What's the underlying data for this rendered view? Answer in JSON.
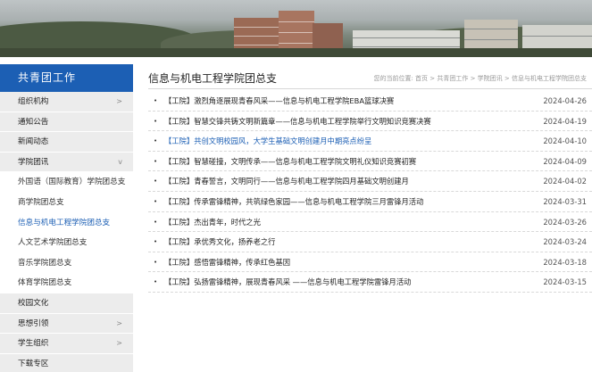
{
  "sidebar": {
    "heading": "共青团工作",
    "items": [
      {
        "label": "组织机构",
        "arrow": ">"
      },
      {
        "label": "通知公告",
        "arrow": ""
      },
      {
        "label": "新闻动态",
        "arrow": ""
      },
      {
        "label": "学院团讯",
        "arrow": "v"
      }
    ],
    "subitems": [
      {
        "label": "外国语（国际教育）学院团总支"
      },
      {
        "label": "商学院团总支"
      },
      {
        "label": "信息与机电工程学院团总支"
      },
      {
        "label": "人文艺术学院团总支"
      },
      {
        "label": "音乐学院团总支"
      },
      {
        "label": "体育学院团总支"
      }
    ],
    "items_after": [
      {
        "label": "校园文化",
        "arrow": ""
      },
      {
        "label": "思想引领",
        "arrow": ">"
      },
      {
        "label": "学生组织",
        "arrow": ">"
      },
      {
        "label": "下载专区",
        "arrow": ""
      }
    ]
  },
  "main": {
    "title": "信息与机电工程学院团总支",
    "location_label": "您的当前位置:",
    "breadcrumb": "首页 > 共青团工作 > 学院团讯 > 信息与机电工程学院团总支",
    "bullet": "•",
    "news": [
      {
        "title": "【工院】激烈角逐展现青春风采——信息与机电工程学院EBA篮球决赛",
        "date": "2024-04-26"
      },
      {
        "title": "【工院】智慧交锋共铸文明新篇章——信息与机电工程学院举行文明知识竞赛决赛",
        "date": "2024-04-19"
      },
      {
        "title": "【工院】共创文明校园风，大学生基础文明创建月中期亮点纷呈",
        "date": "2024-04-10"
      },
      {
        "title": "【工院】智慧碰撞，文明传承——信息与机电工程学院文明礼仪知识竞赛初赛",
        "date": "2024-04-09"
      },
      {
        "title": "【工院】青春誓言，文明同行——信息与机电工程学院四月基础文明创建月",
        "date": "2024-04-02"
      },
      {
        "title": "【工院】传承雷锋精神，共筑绿色家园——信息与机电工程学院三月雷锋月活动",
        "date": "2024-03-31"
      },
      {
        "title": "【工院】杰出青年，时代之光",
        "date": "2024-03-26"
      },
      {
        "title": "【工院】承优秀文化，扬养老之行",
        "date": "2024-03-24"
      },
      {
        "title": "【工院】感悟雷锋精神，传承红色基因",
        "date": "2024-03-18"
      },
      {
        "title": "【工院】弘扬雷锋精神，展现青春风采 ——信息与机电工程学院雷锋月活动",
        "date": "2024-03-15"
      }
    ]
  },
  "colors": {
    "accent": "#1c5fb4",
    "sidebar_bg": "#ececec",
    "link_highlight": "#1c5fb4"
  }
}
